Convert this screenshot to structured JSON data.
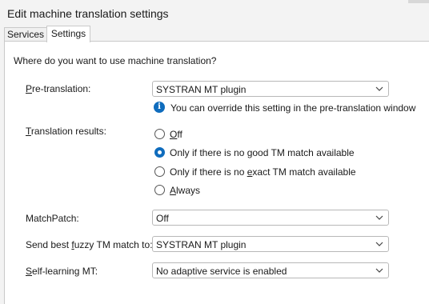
{
  "window": {
    "title": "Edit machine translation settings"
  },
  "tabs": [
    {
      "label": "Services",
      "selected": false
    },
    {
      "label": "Settings",
      "selected": true
    }
  ],
  "settings": {
    "question": "Where do you want to use machine translation?",
    "pretranslation": {
      "label_key": "P",
      "label_rest": "re-translation:",
      "value": "SYSTRAN MT plugin",
      "info_text": "You can override this setting in the pre-translation window"
    },
    "translation_results": {
      "label_key": "T",
      "label_rest": "ranslation results:",
      "options": [
        {
          "key": "O",
          "rest": "ff",
          "prefix": "",
          "selected": false
        },
        {
          "key": "",
          "rest": "Only if there is no good TM match available",
          "prefix": "",
          "selected": true
        },
        {
          "key": "e",
          "rest": "xact TM match available",
          "prefix": "Only if there is no ",
          "selected": false
        },
        {
          "key": "A",
          "rest": "lways",
          "prefix": "",
          "selected": false
        }
      ]
    },
    "matchpatch": {
      "label": "MatchPatch:",
      "value": "Off"
    },
    "fuzzy": {
      "label_pre": "Send best ",
      "label_key": "f",
      "label_rest": "uzzy TM match to:",
      "value": "SYSTRAN MT plugin"
    },
    "selflearning": {
      "label_key": "S",
      "label_rest": "elf-learning MT:",
      "value": "No adaptive service is enabled"
    }
  },
  "colors": {
    "accent": "#0f6cbd",
    "background": "#f3f3f3",
    "panel": "#ffffff"
  },
  "icons": {
    "info": "info-icon",
    "dropdown": "chevron-down-icon",
    "info_glyph": "i"
  }
}
